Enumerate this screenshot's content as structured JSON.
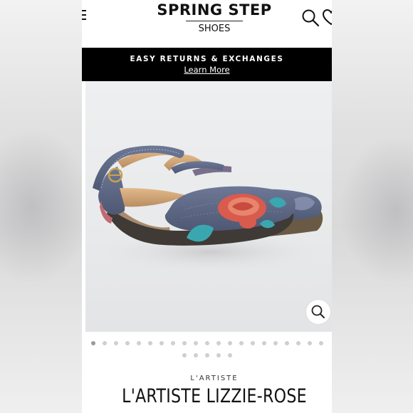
{
  "header": {
    "brand_name": "SPRING STEP",
    "brand_sub": "SHOES",
    "icons": [
      "menu-icon",
      "search-icon",
      "heart-icon"
    ]
  },
  "promo": {
    "text": "EASY RETURNS & EXCHANGES",
    "link": "Learn More"
  },
  "gallery": {
    "zoom_icon": "zoom-icon",
    "dots_row1": 21,
    "dots_row2": 5,
    "active_dot": 1
  },
  "product": {
    "vendor": "L'ARTISTE",
    "title": "L'ARTISTE LIZZIE-ROSE"
  },
  "colors": {
    "promo_bg": "#000000",
    "shoe_leather": "#5e6a87",
    "rose": "#d9574b",
    "leaves": "#3aa7b0"
  }
}
